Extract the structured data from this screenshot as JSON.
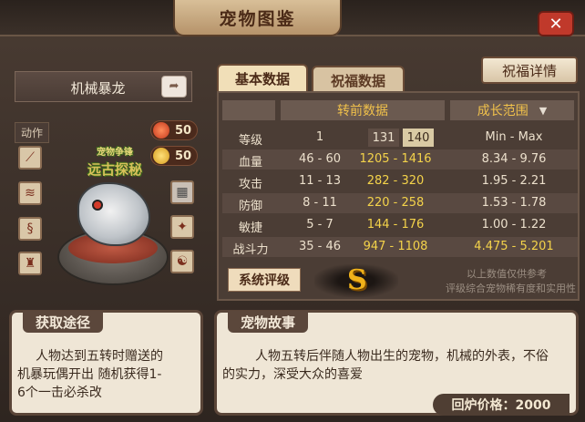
{
  "window": {
    "title": "宠物图鉴",
    "close_icon": "close-icon"
  },
  "pet": {
    "name": "机械暴龙",
    "share_icon": "share-icon",
    "action_label": "动作",
    "badges": [
      {
        "value": "50",
        "color": "#d9462a"
      },
      {
        "value": "50",
        "color": "#e8a21c"
      }
    ],
    "logo": {
      "line1": "宠物争锋",
      "line2": "远古探秘"
    },
    "skills_left": [
      "claw-skill-icon",
      "fang-skill-icon",
      "serpent-skill-icon",
      "totem-skill-icon"
    ],
    "skills_right": [
      "armor-skill-icon",
      "beast-skill-icon",
      "demon-skill-icon"
    ]
  },
  "tabs": {
    "basic": "基本数据",
    "bless": "祝福数据"
  },
  "bless_detail_button": "祝福详情",
  "table": {
    "header_pre": "转前数据",
    "header_range": "成长范围",
    "rows": [
      {
        "label": "等级",
        "base": "1",
        "lv_a": "131",
        "lv_b": "140",
        "range": "Min - Max"
      },
      {
        "label": "血量",
        "base": "46 - 60",
        "pre": "1205 - 1416",
        "range": "8.34 - 9.76"
      },
      {
        "label": "攻击",
        "base": "11 - 13",
        "pre": "282 - 320",
        "range": "1.95 - 2.21"
      },
      {
        "label": "防御",
        "base": "8 - 11",
        "pre": "220 - 258",
        "range": "1.53 - 1.78"
      },
      {
        "label": "敏捷",
        "base": "5 - 7",
        "pre": "144 - 176",
        "range": "1.00 - 1.22"
      },
      {
        "label": "战斗力",
        "base": "35 - 46",
        "pre": "947 - 1108",
        "range": "4.475 - 5.201"
      }
    ]
  },
  "rating": {
    "button": "系统评级",
    "grade": "S",
    "note1": "以上数值仅供参考",
    "note2": "评级综合宠物稀有度和实用性"
  },
  "acquire": {
    "title": "获取途径",
    "line1": "人物达到五转时赠送的",
    "line2": "机暴玩偶开出  随机获得1-",
    "line3": "6个一击必杀改"
  },
  "story": {
    "title": "宠物故事",
    "line1": "人物五转后伴随人物出生的宠物，机械的外表，不俗",
    "line2": "的实力，深受大众的喜爱",
    "price_label": "回炉价格：2000"
  }
}
